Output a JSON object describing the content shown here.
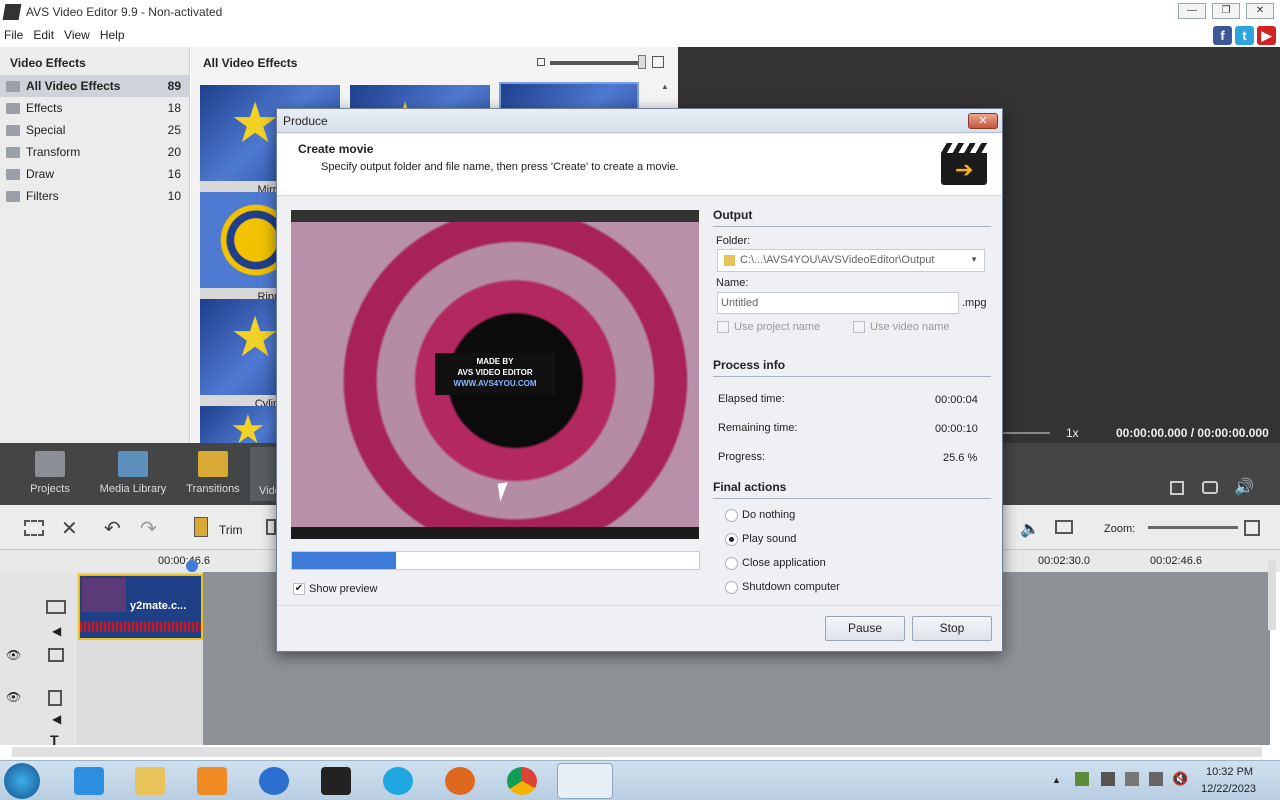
{
  "window": {
    "title": "AVS Video Editor 9.9 - Non-activated"
  },
  "menu": [
    "File",
    "Edit",
    "View",
    "Help"
  ],
  "left_panel": {
    "header": "Video Effects",
    "items": [
      {
        "label": "All Video Effects",
        "count": "89"
      },
      {
        "label": "Effects",
        "count": "18"
      },
      {
        "label": "Special",
        "count": "25"
      },
      {
        "label": "Transform",
        "count": "20"
      },
      {
        "label": "Draw",
        "count": "16"
      },
      {
        "label": "Filters",
        "count": "10"
      }
    ]
  },
  "middle_panel": {
    "header": "All Video Effects",
    "thumb_captions": [
      "Mirro",
      "Rippl",
      "Cylind"
    ]
  },
  "player": {
    "speed": "1x",
    "time": "00:00:00.000 / 00:00:00.000"
  },
  "main_toolbar": [
    "Projects",
    "Media Library",
    "Transitions",
    "Vide"
  ],
  "edit_toolbar": {
    "trim": "Trim",
    "zoom": "Zoom:"
  },
  "ruler": [
    "00:00:46.6",
    "00:02:30.0",
    "00:02:46.6"
  ],
  "clip": {
    "name": "y2mate.c..."
  },
  "dialog": {
    "title": "Produce",
    "heading": "Create movie",
    "subheading": "Specify output folder and file name, then press 'Create' to create a movie.",
    "preview_logo": [
      "MADE BY",
      "AVS VIDEO EDITOR",
      "WWW.AVS4YOU.COM"
    ],
    "progress_fraction": 0.256,
    "show_preview": "Show preview",
    "output": {
      "section": "Output",
      "folder_label": "Folder:",
      "folder_value": "C:\\...\\AVS4YOU\\AVSVideoEditor\\Output",
      "name_label": "Name:",
      "name_value": "Untitled",
      "extension": ".mpg",
      "use_project_name": "Use project name",
      "use_video_name": "Use video name"
    },
    "process": {
      "section": "Process info",
      "elapsed_label": "Elapsed time:",
      "elapsed_value": "00:00:04",
      "remaining_label": "Remaining time:",
      "remaining_value": "00:00:10",
      "progress_label": "Progress:",
      "progress_value": "25.6 %"
    },
    "final": {
      "section": "Final actions",
      "options": [
        "Do nothing",
        "Play sound",
        "Close application",
        "Shutdown computer"
      ],
      "selected": "Play sound"
    },
    "buttons": {
      "pause": "Pause",
      "stop": "Stop"
    }
  },
  "taskbar": {
    "time": "10:32 PM",
    "date": "12/22/2023"
  }
}
